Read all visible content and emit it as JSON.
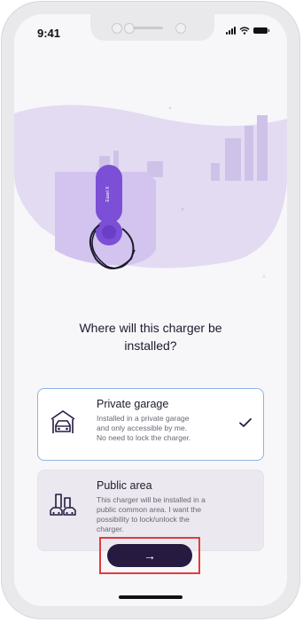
{
  "status_bar": {
    "time": "9:41"
  },
  "hero": {
    "charger_label": "Easel X"
  },
  "question": {
    "line1": "Where will this charger be",
    "line2": "installed?"
  },
  "options": [
    {
      "title": "Private garage",
      "desc": [
        "Installed in a private garage",
        "and only accessible by me.",
        "No need to lock the charger."
      ],
      "icon": "garage-car-icon",
      "selected": true
    },
    {
      "title": "Public area",
      "desc": [
        "This charger will be installed in a",
        "public common area. I want the",
        "possibility to lock/unlock the",
        "charger."
      ],
      "icon": "public-parking-icon",
      "selected": false
    }
  ],
  "cta": {
    "label": "→"
  },
  "colors": {
    "accent": "#7b4fd6",
    "cta_bg": "#261a40",
    "highlight_border": "#e23b3b",
    "selected_border": "#8fb4e4"
  }
}
